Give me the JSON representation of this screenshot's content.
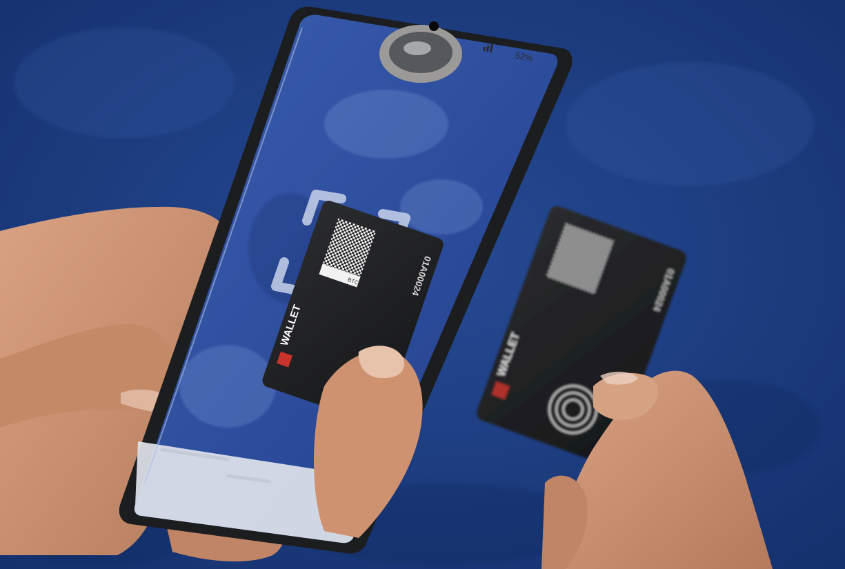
{
  "photo": {
    "subject": "Two hands with a smartphone scanning a WALLET card, and the physical card held in the other hand",
    "colors": {
      "carpet": "#1f3f86",
      "carpet_dark": "#142f6e",
      "phone_case": "#1b1d1f",
      "card": "#1e1f21",
      "skin": "#c98f6f",
      "wallet_red": "#c8332e"
    }
  },
  "phone": {
    "status_bar": {
      "battery": "52%"
    },
    "camera_overlay": {
      "viewfinder": "scan-frame"
    }
  },
  "card_on_screen": {
    "brand": "WALLET",
    "serial": "01A00024",
    "badge": "BTC"
  },
  "card_in_hand": {
    "brand": "WALLET",
    "serial": "01A00024"
  }
}
